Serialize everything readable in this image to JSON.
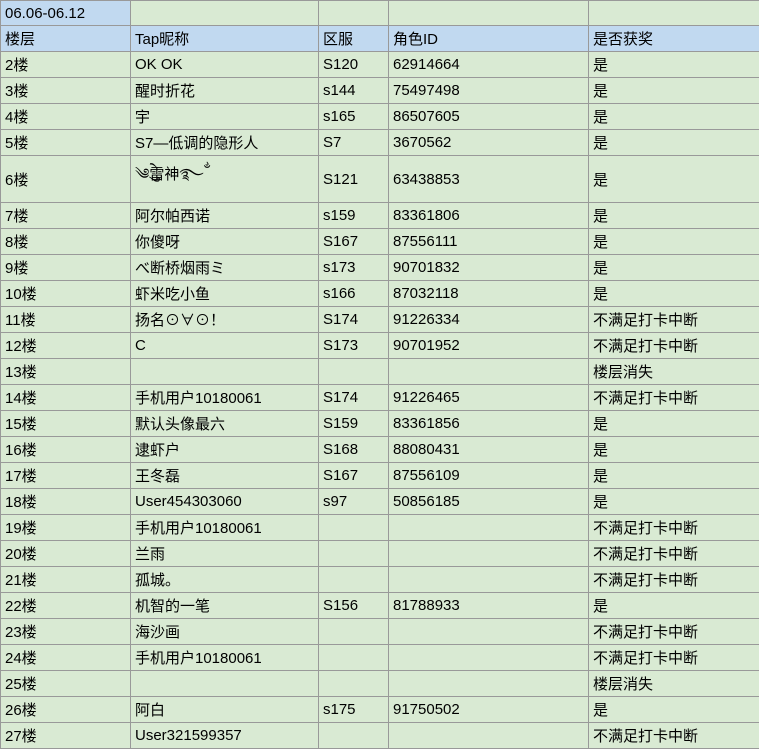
{
  "title": "06.06-06.12",
  "headers": {
    "floor": "楼层",
    "tap": "Tap昵称",
    "server": "区服",
    "roleid": "角色ID",
    "award": "是否获奖"
  },
  "rows": [
    {
      "floor": "2楼",
      "tap": "OK OK",
      "server": "S120",
      "roleid": "62914664",
      "award": "是"
    },
    {
      "floor": "3楼",
      "tap": "醒时折花",
      "server": "s144",
      "roleid": "75497498",
      "award": "是"
    },
    {
      "floor": "4楼",
      "tap": "宇",
      "server": "s165",
      "roleid": "86507605",
      "award": "是"
    },
    {
      "floor": "5楼",
      "tap": "S7—低调的隐形人",
      "server": "S7",
      "roleid": "3670562",
      "award": "是"
    },
    {
      "floor": "6楼",
      "tap": "༄ེུ雷神࿐ྂ",
      "server": "S121",
      "roleid": "63438853",
      "award": "是"
    },
    {
      "floor": "7楼",
      "tap": "阿尔帕西诺",
      "server": "s159",
      "roleid": "83361806",
      "award": "是"
    },
    {
      "floor": "8楼",
      "tap": "你傻呀",
      "server": "S167",
      "roleid": "87556111",
      "award": "是"
    },
    {
      "floor": "9楼",
      "tap": "べ断桥烟雨ミ",
      "server": "s173",
      "roleid": "90701832",
      "award": "是"
    },
    {
      "floor": "10楼",
      "tap": "虾米吃小鱼",
      "server": "s166",
      "roleid": "87032118",
      "award": "是"
    },
    {
      "floor": "11楼",
      "tap": "扬名⊙∀⊙！",
      "server": "S174",
      "roleid": "91226334",
      "award": "不满足打卡中断"
    },
    {
      "floor": "12楼",
      "tap": "C",
      "server": "S173",
      "roleid": "90701952",
      "award": "不满足打卡中断"
    },
    {
      "floor": "13楼",
      "tap": "",
      "server": "",
      "roleid": "",
      "award": "楼层消失"
    },
    {
      "floor": "14楼",
      "tap": "手机用户10180061",
      "server": "S174",
      "roleid": "91226465",
      "award": "不满足打卡中断"
    },
    {
      "floor": "15楼",
      "tap": "默认头像最六",
      "server": "S159",
      "roleid": "83361856",
      "award": "是"
    },
    {
      "floor": "16楼",
      "tap": "逮虾户",
      "server": "S168",
      "roleid": "88080431",
      "award": "是"
    },
    {
      "floor": "17楼",
      "tap": "王冬磊",
      "server": "S167",
      "roleid": "87556109",
      "award": "是"
    },
    {
      "floor": "18楼",
      "tap": "User454303060",
      "server": "s97",
      "roleid": "50856185",
      "award": "是"
    },
    {
      "floor": "19楼",
      "tap": "手机用户10180061",
      "server": "",
      "roleid": "",
      "award": "不满足打卡中断"
    },
    {
      "floor": "20楼",
      "tap": "兰雨",
      "server": "",
      "roleid": "",
      "award": "不满足打卡中断"
    },
    {
      "floor": "21楼",
      "tap": "孤城。",
      "server": "",
      "roleid": "",
      "award": "不满足打卡中断"
    },
    {
      "floor": "22楼",
      "tap": "机智的一笔",
      "server": "S156",
      "roleid": "81788933",
      "award": "是"
    },
    {
      "floor": "23楼",
      "tap": "海沙画",
      "server": "",
      "roleid": "",
      "award": "不满足打卡中断"
    },
    {
      "floor": "24楼",
      "tap": "手机用户10180061",
      "server": "",
      "roleid": "",
      "award": "不满足打卡中断"
    },
    {
      "floor": "25楼",
      "tap": "",
      "server": "",
      "roleid": "",
      "award": "楼层消失"
    },
    {
      "floor": "26楼",
      "tap": "阿白",
      "server": "s175",
      "roleid": "91750502",
      "award": "是"
    },
    {
      "floor": "27楼",
      "tap": "User321599357",
      "server": "",
      "roleid": "",
      "award": "不满足打卡中断"
    }
  ]
}
